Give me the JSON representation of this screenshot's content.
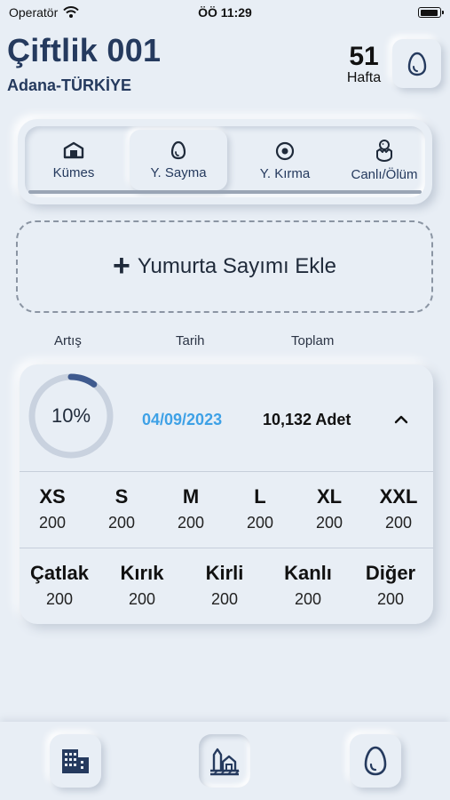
{
  "status_bar": {
    "carrier": "Operatör",
    "time": "ÖÖ 11:29"
  },
  "header": {
    "title": "Çiftlik 001",
    "location": "Adana-TÜRKİYE",
    "week_number": "51",
    "week_label": "Hafta"
  },
  "tabs": [
    {
      "label": "Kümes",
      "icon": "coop-icon",
      "active": false
    },
    {
      "label": "Y. Sayma",
      "icon": "egg-icon",
      "active": true
    },
    {
      "label": "Y. Kırma",
      "icon": "broken-egg-icon",
      "active": false
    },
    {
      "label": "Canlı/Ölüm",
      "icon": "chick-icon",
      "active": false
    }
  ],
  "add_button": {
    "label": "Yumurta Sayımı Ekle"
  },
  "columns": {
    "increase": "Artış",
    "date": "Tarih",
    "total": "Toplam"
  },
  "record": {
    "percent_label": "10%",
    "percent_value": 10,
    "date": "04/09/2023",
    "total": "10,132 Adet",
    "sizes": [
      {
        "label": "XS",
        "value": "200"
      },
      {
        "label": "S",
        "value": "200"
      },
      {
        "label": "M",
        "value": "200"
      },
      {
        "label": "L",
        "value": "200"
      },
      {
        "label": "XL",
        "value": "200"
      },
      {
        "label": "XXL",
        "value": "200"
      }
    ],
    "defects": [
      {
        "label": "Çatlak",
        "value": "200"
      },
      {
        "label": "Kırık",
        "value": "200"
      },
      {
        "label": "Kirli",
        "value": "200"
      },
      {
        "label": "Kanlı",
        "value": "200"
      },
      {
        "label": "Diğer",
        "value": "200"
      }
    ]
  },
  "bottom_nav": [
    {
      "icon": "building-icon"
    },
    {
      "icon": "farm-icon",
      "active": true
    },
    {
      "icon": "egg-icon"
    }
  ],
  "colors": {
    "background": "#e8eef5",
    "primary": "#253a5e",
    "date_accent": "#3ea1e6",
    "ring_track": "#c9d2df",
    "ring_fill": "#3f5a8e"
  }
}
